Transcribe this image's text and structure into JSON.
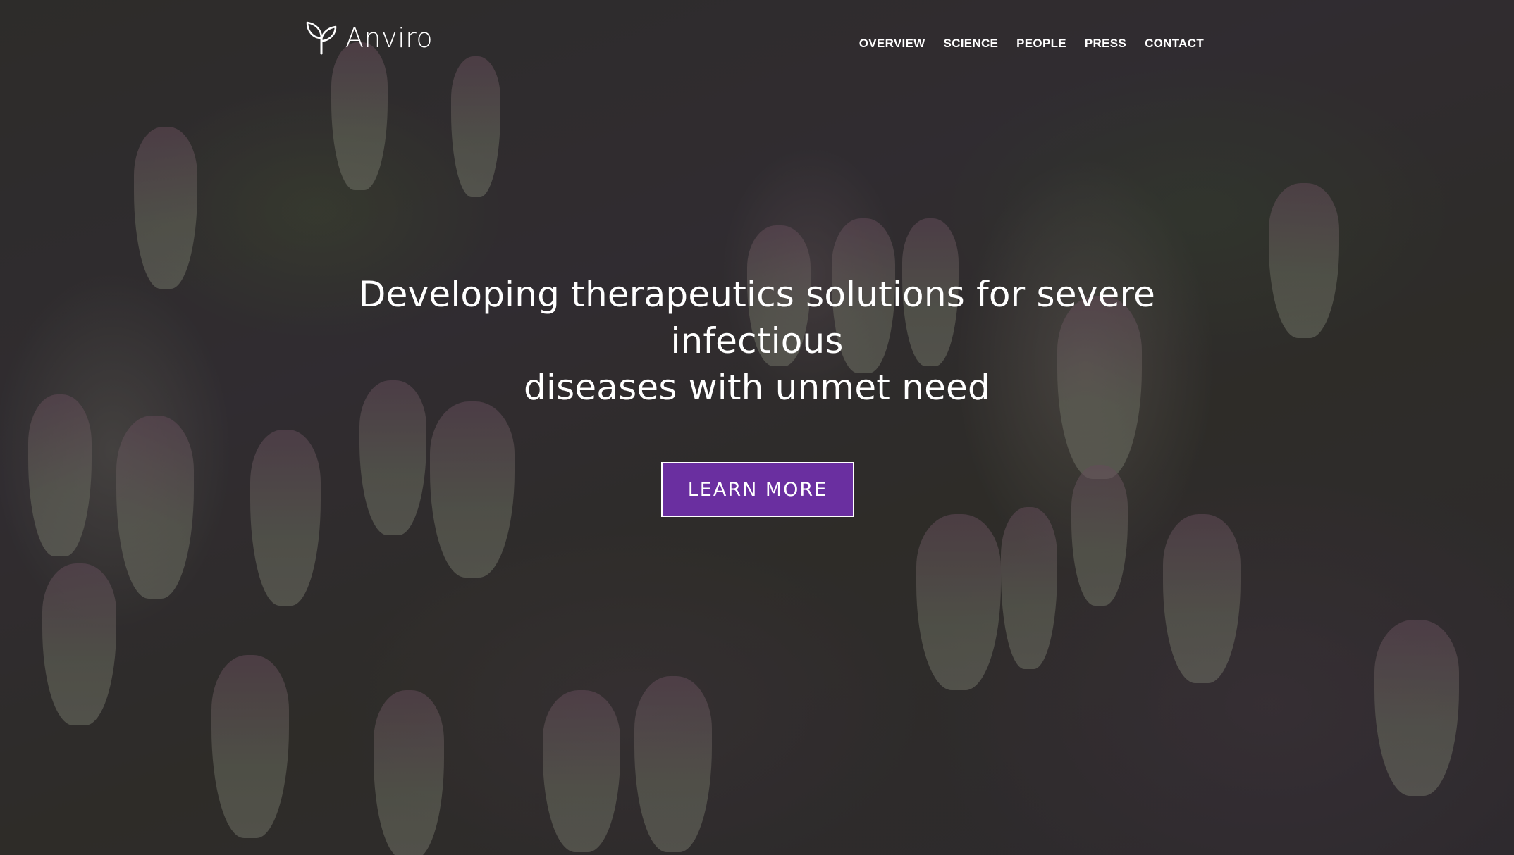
{
  "brand": {
    "name": "Anviro",
    "logo_icon": "sprout-icon"
  },
  "nav": {
    "items": [
      {
        "label": "OVERVIEW"
      },
      {
        "label": "SCIENCE"
      },
      {
        "label": "PEOPLE"
      },
      {
        "label": "PRESS"
      },
      {
        "label": "CONTACT"
      }
    ]
  },
  "hero": {
    "headline_line1": "Developing therapeutics solutions for severe infectious",
    "headline_line2": "diseases with unmet need",
    "cta_label": "LEARN MORE",
    "background_image": "flowering-kalanchoe-photo"
  },
  "colors": {
    "accent": "#6a2fa0",
    "text": "#ffffff"
  }
}
